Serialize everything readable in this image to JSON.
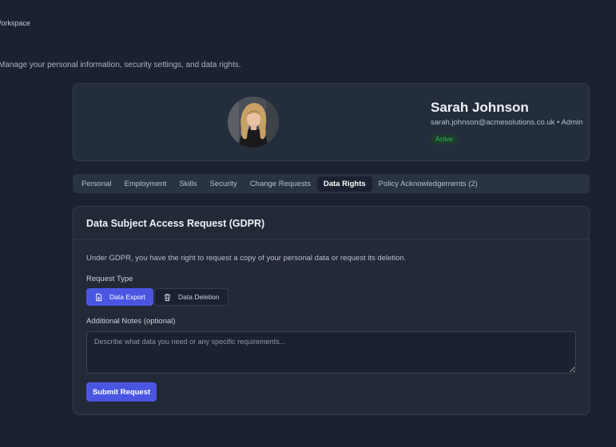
{
  "header": {
    "workspace_label": "Workspace",
    "subtitle": "Manage your personal information, security settings, and data rights."
  },
  "profile": {
    "name": "Sarah Johnson",
    "email": "sarah.johnson@acmesolutions.co.uk",
    "role": "Admin",
    "meta": "sarah.johnson@acmesolutions.co.uk • Admin",
    "status": "Active",
    "status_color": "#2fbf5f"
  },
  "tabs": [
    {
      "label": "Personal",
      "active": false
    },
    {
      "label": "Employment",
      "active": false
    },
    {
      "label": "Skills",
      "active": false
    },
    {
      "label": "Security",
      "active": false
    },
    {
      "label": "Change Requests",
      "active": false
    },
    {
      "label": "Data Rights",
      "active": true
    },
    {
      "label": "Policy Acknowledgements (2)",
      "active": false
    }
  ],
  "request": {
    "title": "Data Subject Access Request (GDPR)",
    "description": "Under GDPR, you have the right to request a copy of your personal data or request its deletion.",
    "type_label": "Request Type",
    "types": [
      {
        "label": "Data Export",
        "icon": "file-export-icon",
        "selected": true
      },
      {
        "label": "Data Deletion",
        "icon": "trash-icon",
        "selected": false
      }
    ],
    "notes_label": "Additional Notes (optional)",
    "notes_placeholder": "Describe what data you need or any specific requirements...",
    "notes_value": "",
    "submit_label": "Submit Request"
  },
  "colors": {
    "accent": "#4a56e2",
    "background": "#1b2130",
    "card": "#242d3c"
  }
}
